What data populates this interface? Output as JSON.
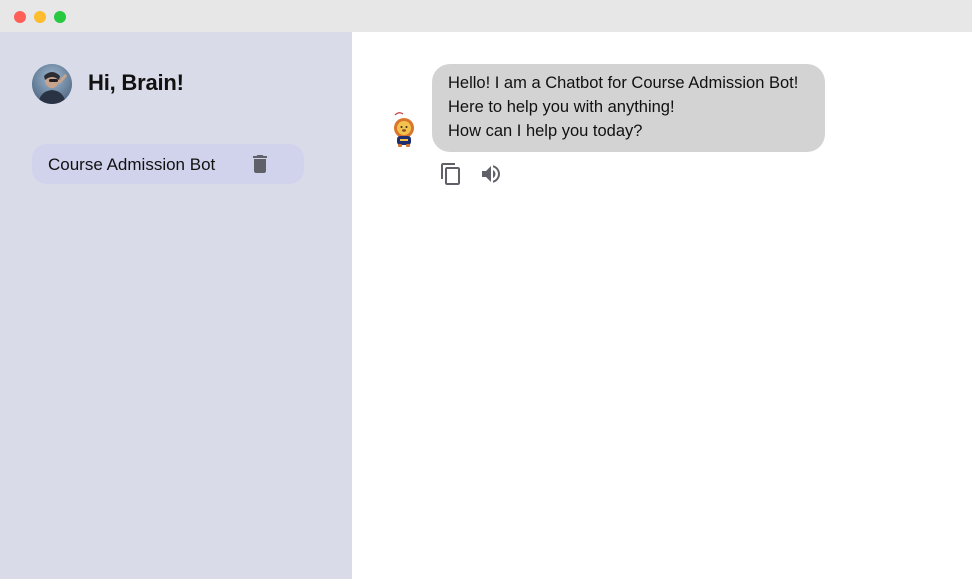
{
  "window": {
    "controls": [
      "close",
      "minimize",
      "maximize"
    ]
  },
  "sidebar": {
    "greeting": "Hi, Brain!",
    "avatar_icon": "user-photo-avatar",
    "chats": [
      {
        "label": "Course Admission Bot",
        "delete_icon": "trash-icon"
      }
    ]
  },
  "conversation": {
    "messages": [
      {
        "role": "bot",
        "avatar_icon": "lion-mascot-icon",
        "lines": [
          "Hello! I am a Chatbot for Course Admission Bot!",
          "Here to help you with anything!",
          "How can I help you today?"
        ],
        "actions": [
          {
            "name": "copy",
            "icon": "copy-icon"
          },
          {
            "name": "read-aloud",
            "icon": "speaker-icon"
          }
        ]
      }
    ]
  },
  "colors": {
    "sidebar_bg": "#dadbe8",
    "chat_item_bg": "#d1d3ec",
    "bubble_bg": "#d3d3d3",
    "titlebar_bg": "#e7e7e7"
  }
}
